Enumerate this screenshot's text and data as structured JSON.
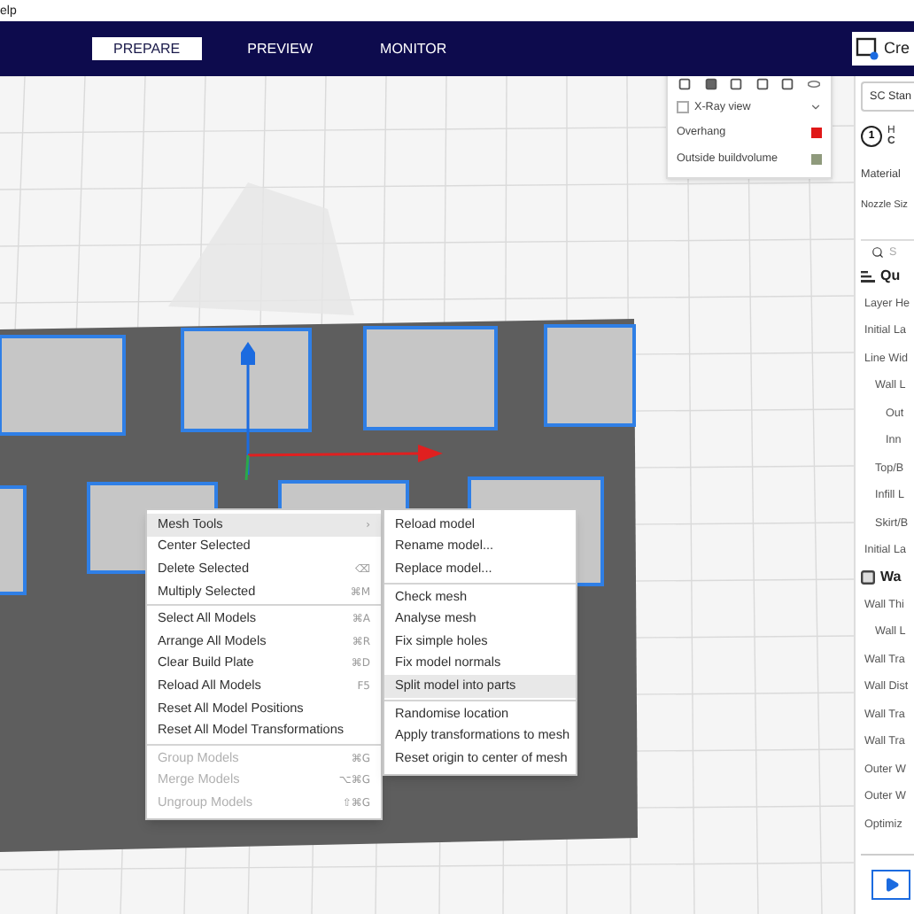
{
  "menu_bar": {
    "item": "elp"
  },
  "stage_tabs": [
    {
      "label": "PREPARE",
      "selected": true
    },
    {
      "label": "PREVIEW",
      "selected": false
    },
    {
      "label": "MONITOR",
      "selected": false
    }
  ],
  "create_button": {
    "label": "Cre"
  },
  "view_panel": {
    "xray": {
      "label": "X-Ray view",
      "checked": false
    },
    "legend": [
      {
        "label": "Overhang",
        "color": "#e01818"
      },
      {
        "label": "Outside buildvolume",
        "color": "#8f9a7c"
      }
    ]
  },
  "context_menu": {
    "groups": [
      [
        {
          "label": "Mesh Tools",
          "shortcut": "›",
          "selected": true,
          "disabled": false
        },
        {
          "label": "Center Selected",
          "selected": false,
          "disabled": false
        },
        {
          "label": "Delete Selected",
          "shortcut": "⌫",
          "selected": false,
          "disabled": false
        },
        {
          "label": "Multiply Selected",
          "shortcut": "⌘M",
          "selected": false,
          "disabled": false
        }
      ],
      [
        {
          "label": "Select All Models",
          "shortcut": "⌘A",
          "selected": false,
          "disabled": false
        },
        {
          "label": "Arrange All Models",
          "shortcut": "⌘R",
          "selected": false,
          "disabled": false
        },
        {
          "label": "Clear Build Plate",
          "shortcut": "⌘D",
          "selected": false,
          "disabled": false
        },
        {
          "label": "Reload All Models",
          "shortcut": "F5",
          "selected": false,
          "disabled": false
        },
        {
          "label": "Reset All Model Positions",
          "selected": false,
          "disabled": false
        },
        {
          "label": "Reset All Model Transformations",
          "selected": false,
          "disabled": false
        }
      ],
      [
        {
          "label": "Group Models",
          "shortcut": "⌘G",
          "selected": false,
          "disabled": true
        },
        {
          "label": "Merge Models",
          "shortcut": "⌥⌘G",
          "selected": false,
          "disabled": true
        },
        {
          "label": "Ungroup Models",
          "shortcut": "⇧⌘G",
          "selected": false,
          "disabled": true
        }
      ]
    ]
  },
  "submenu": {
    "groups": [
      [
        {
          "label": "Reload model",
          "selected": false
        },
        {
          "label": "Rename model...",
          "selected": false
        },
        {
          "label": "Replace model...",
          "selected": false
        }
      ],
      [
        {
          "label": "Check mesh",
          "selected": false
        },
        {
          "label": "Analyse mesh",
          "selected": false
        },
        {
          "label": "Fix simple holes",
          "selected": false
        },
        {
          "label": "Fix model normals",
          "selected": false
        },
        {
          "label": "Split model into parts",
          "selected": true
        }
      ],
      [
        {
          "label": "Randomise location",
          "selected": false
        },
        {
          "label": "Apply transformations to mesh",
          "selected": false
        },
        {
          "label": "Reset origin to center of mesh",
          "selected": false
        }
      ]
    ]
  },
  "settings_panel": {
    "profile": "SC Stan",
    "extruder": {
      "number": "1",
      "line_1": "H",
      "line_2": "C"
    },
    "material_label": "Material",
    "nozzle_label": "Nozzle Siz",
    "search_placeholder": "S",
    "sections": [
      {
        "title": "Qu",
        "kind": "quality",
        "items": [
          {
            "label": "Layer He"
          },
          {
            "label": "Initial La"
          },
          {
            "label": "Line Wid",
            "children": [
              {
                "label": "Wall L",
                "children": [
                  {
                    "label": "Out"
                  },
                  {
                    "label": "Inn"
                  }
                ]
              },
              {
                "label": "Top/B"
              },
              {
                "label": "Infill L"
              },
              {
                "label": "Skirt/B"
              }
            ]
          },
          {
            "label": "Initial La"
          }
        ]
      },
      {
        "title": "Wa",
        "kind": "walls",
        "items": [
          {
            "label": "Wall Thi",
            "children": [
              {
                "label": "Wall L"
              }
            ]
          },
          {
            "label": "Wall Tra"
          },
          {
            "label": "Wall Dist"
          },
          {
            "label": "Wall Tra"
          },
          {
            "label": "Wall Tra"
          },
          {
            "label": "Outer W"
          },
          {
            "label": "Outer W"
          },
          {
            "label": "Optimiz"
          }
        ]
      }
    ]
  }
}
